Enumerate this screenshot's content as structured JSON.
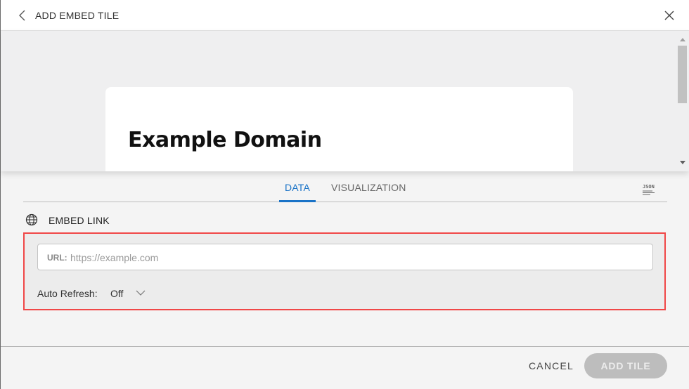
{
  "header": {
    "title": "ADD EMBED TILE",
    "back_icon": "chevron-left-icon",
    "close_icon": "close-icon"
  },
  "preview": {
    "heading": "Example Domain"
  },
  "tabs": [
    {
      "label": "DATA",
      "active": true
    },
    {
      "label": "VISUALIZATION",
      "active": false
    }
  ],
  "json_button": {
    "icon": "json-icon",
    "label": "JSON"
  },
  "section": {
    "icon": "globe-icon",
    "label": "EMBED LINK"
  },
  "url_field": {
    "label": "URL:",
    "value": "",
    "placeholder": "https://example.com"
  },
  "auto_refresh": {
    "label": "Auto Refresh:",
    "value": "Off"
  },
  "footer": {
    "cancel_label": "CANCEL",
    "add_label": "ADD TILE"
  },
  "colors": {
    "accent": "#1a73c7",
    "highlight_border": "#f04747",
    "disabled_button": "#bdbdbd"
  }
}
